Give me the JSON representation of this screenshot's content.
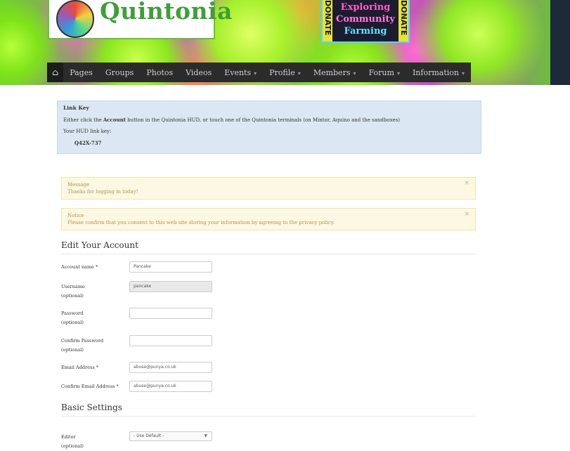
{
  "site": {
    "logo_text": "Quintonia",
    "promo": {
      "side_left": "DONATE",
      "side_right": "DONATE",
      "line1": "Exploring",
      "line2": "Community",
      "line3": "Farming"
    }
  },
  "nav": {
    "home_icon": "⌂",
    "items": [
      {
        "label": "Pages",
        "dropdown": false
      },
      {
        "label": "Groups",
        "dropdown": false
      },
      {
        "label": "Photos",
        "dropdown": false
      },
      {
        "label": "Videos",
        "dropdown": false
      },
      {
        "label": "Events",
        "dropdown": true
      },
      {
        "label": "Profile",
        "dropdown": true
      },
      {
        "label": "Members",
        "dropdown": true
      },
      {
        "label": "Forum",
        "dropdown": true
      },
      {
        "label": "Information",
        "dropdown": true
      }
    ],
    "caret": "▾"
  },
  "link_key": {
    "title": "Link Key",
    "text_before": "Either click the ",
    "text_bold": "Account",
    "text_after": " button in the Quintonia HUD, or touch one of the Quintonia terminals (on Mintor, Aquino and the sandboxes)",
    "key_label": "Your HUD link key:",
    "key_value": "Q42X-737"
  },
  "alerts": [
    {
      "title": "Message",
      "text": "Thanks for logging in today!",
      "close": "×"
    },
    {
      "title": "Notice",
      "text": "Please confirm that you consent to this web site storing your information by agreeing to the privacy policy.",
      "close": "×"
    }
  ],
  "edit_account": {
    "heading": "Edit Your Account",
    "fields": {
      "account_name": {
        "label": "Account name *",
        "value": "Pancake"
      },
      "username": {
        "label": "Username",
        "sub": "(optional)",
        "value": "pancake"
      },
      "password": {
        "label": "Password",
        "sub": "(optional)",
        "value": ""
      },
      "confirm_password": {
        "label": "Confirm Password",
        "sub": "(optional)",
        "value": ""
      },
      "email": {
        "label": "Email Address *",
        "value": "abuse@punya.co.uk"
      },
      "confirm_email": {
        "label": "Confirm Email Address *",
        "value": "abuse@punya.co.uk"
      }
    }
  },
  "basic_settings": {
    "heading": "Basic Settings",
    "editor": {
      "label": "Editor",
      "sub": "(optional)",
      "selected": "- Use Default -",
      "arrow": "▼"
    }
  }
}
